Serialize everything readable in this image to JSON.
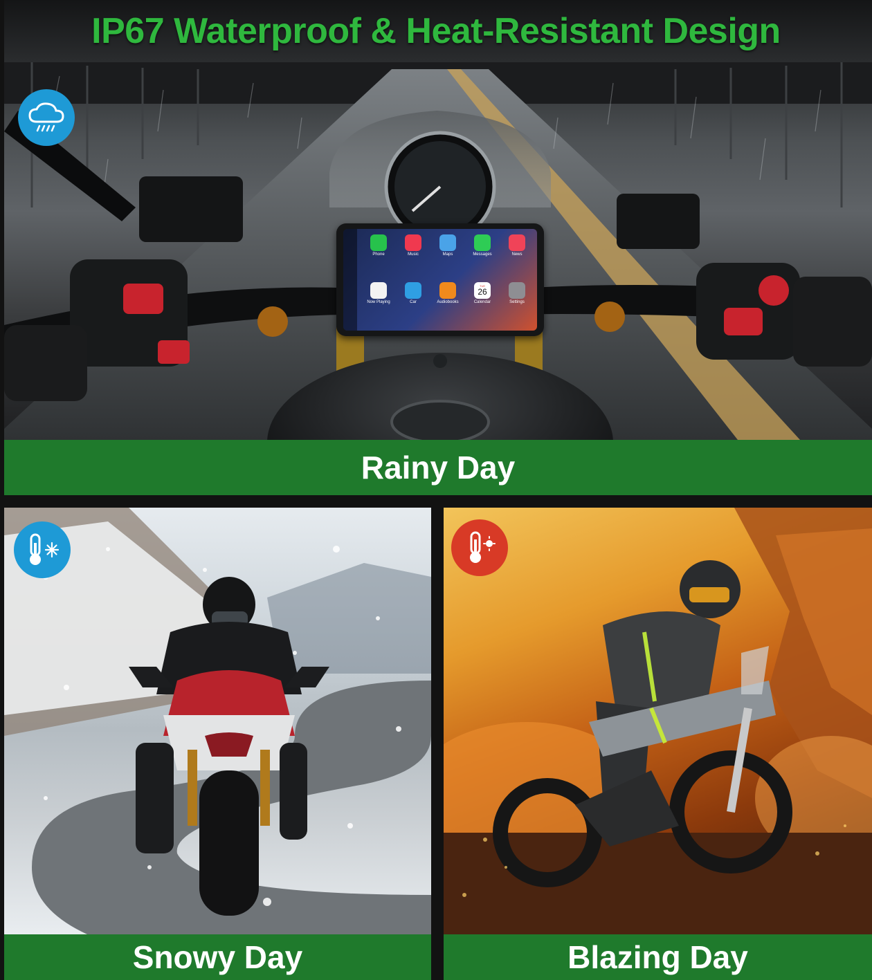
{
  "headline": "IP67 Waterproof  &  Heat-Resistant Design",
  "panels": {
    "rainy": {
      "caption": "Rainy Day",
      "icon": "rain-cloud-icon",
      "badge_color": "#1e9ad6"
    },
    "snowy": {
      "caption": "Snowy Day",
      "icon": "snow-thermometer-icon",
      "badge_color": "#1e9ad6"
    },
    "blazing": {
      "caption": "Blazing Day",
      "icon": "heat-thermometer-icon",
      "badge_color": "#d83a26"
    }
  },
  "screen": {
    "apps": [
      {
        "label": "Phone",
        "color": "#27c24c"
      },
      {
        "label": "Music",
        "color": "#f0394f"
      },
      {
        "label": "Maps",
        "color": "#4aa3e8"
      },
      {
        "label": "Messages",
        "color": "#2ecc55"
      },
      {
        "label": "News",
        "color": "#f04358"
      },
      {
        "label": "Now Playing",
        "color": "#f3f3f3"
      },
      {
        "label": "Car",
        "color": "#2f9fe3"
      },
      {
        "label": "Audiobooks",
        "color": "#f08a1c"
      },
      {
        "label": "Calendar",
        "color": "#ffffff"
      },
      {
        "label": "Settings",
        "color": "#8e8e93"
      }
    ],
    "calendar_day": "TUE",
    "calendar_date": "26"
  },
  "colors": {
    "headline_green": "#2fb83e",
    "caption_green": "#1f7a2c"
  }
}
